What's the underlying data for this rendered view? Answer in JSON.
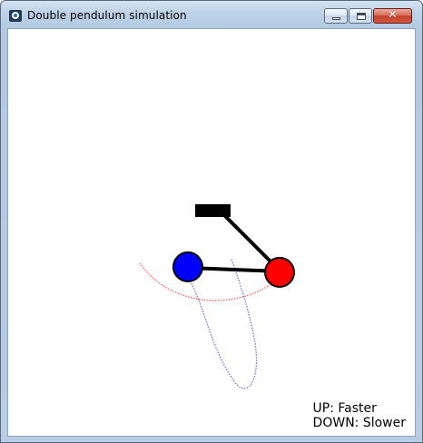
{
  "window": {
    "title": "Double pendulum simulation",
    "icon": "app-icon",
    "controls": {
      "minimize_icon": "minimize-icon",
      "maximize_icon": "maximize-icon",
      "close_glyph": "✕"
    }
  },
  "simulation": {
    "pivot_color": "#000000",
    "rod_color": "#000000",
    "bob_1_color": "#ff0000",
    "bob_2_color": "#0000ff",
    "trail_1_color": "#ff6666",
    "trail_2_color": "#6a6ad8"
  },
  "help": {
    "up": "UP: Faster",
    "down": "DOWN: Slower"
  }
}
